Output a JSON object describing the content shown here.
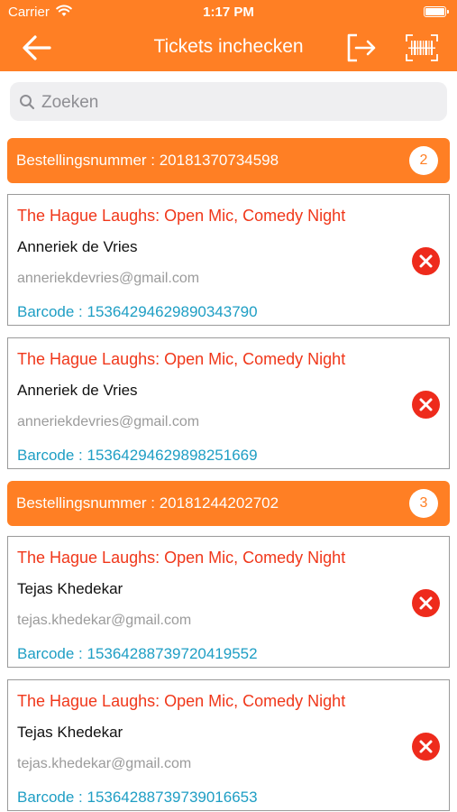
{
  "status_bar": {
    "carrier": "Carrier",
    "time": "1:17 PM"
  },
  "navbar": {
    "title": "Tickets inchecken",
    "back_icon": "arrow-left-icon",
    "logout_icon": "logout-icon",
    "scan_icon": "barcode-scan-icon"
  },
  "search": {
    "placeholder": "Zoeken"
  },
  "colors": {
    "accent": "#ff7f24",
    "event_title": "#f0371a",
    "barcode": "#1e9ec4",
    "remove": "#ee2b1c"
  },
  "orders": [
    {
      "label": "Bestellingsnummer : 20181370734598",
      "count": "2",
      "tickets": [
        {
          "event": "The Hague Laughs: Open Mic, Comedy Night",
          "name": "Anneriek de Vries",
          "email": "anneriekdevries@gmail.com",
          "barcode": "Barcode : 15364294629890343790"
        },
        {
          "event": "The Hague Laughs: Open Mic, Comedy Night",
          "name": "Anneriek de Vries",
          "email": "anneriekdevries@gmail.com",
          "barcode": "Barcode : 15364294629898251669"
        }
      ]
    },
    {
      "label": "Bestellingsnummer : 20181244202702",
      "count": "3",
      "tickets": [
        {
          "event": "The Hague Laughs: Open Mic, Comedy Night",
          "name": "Tejas Khedekar",
          "email": "tejas.khedekar@gmail.com",
          "barcode": "Barcode : 15364288739720419552"
        },
        {
          "event": "The Hague Laughs: Open Mic, Comedy Night",
          "name": "Tejas Khedekar",
          "email": "tejas.khedekar@gmail.com",
          "barcode": "Barcode : 15364288739739016653"
        }
      ]
    }
  ]
}
